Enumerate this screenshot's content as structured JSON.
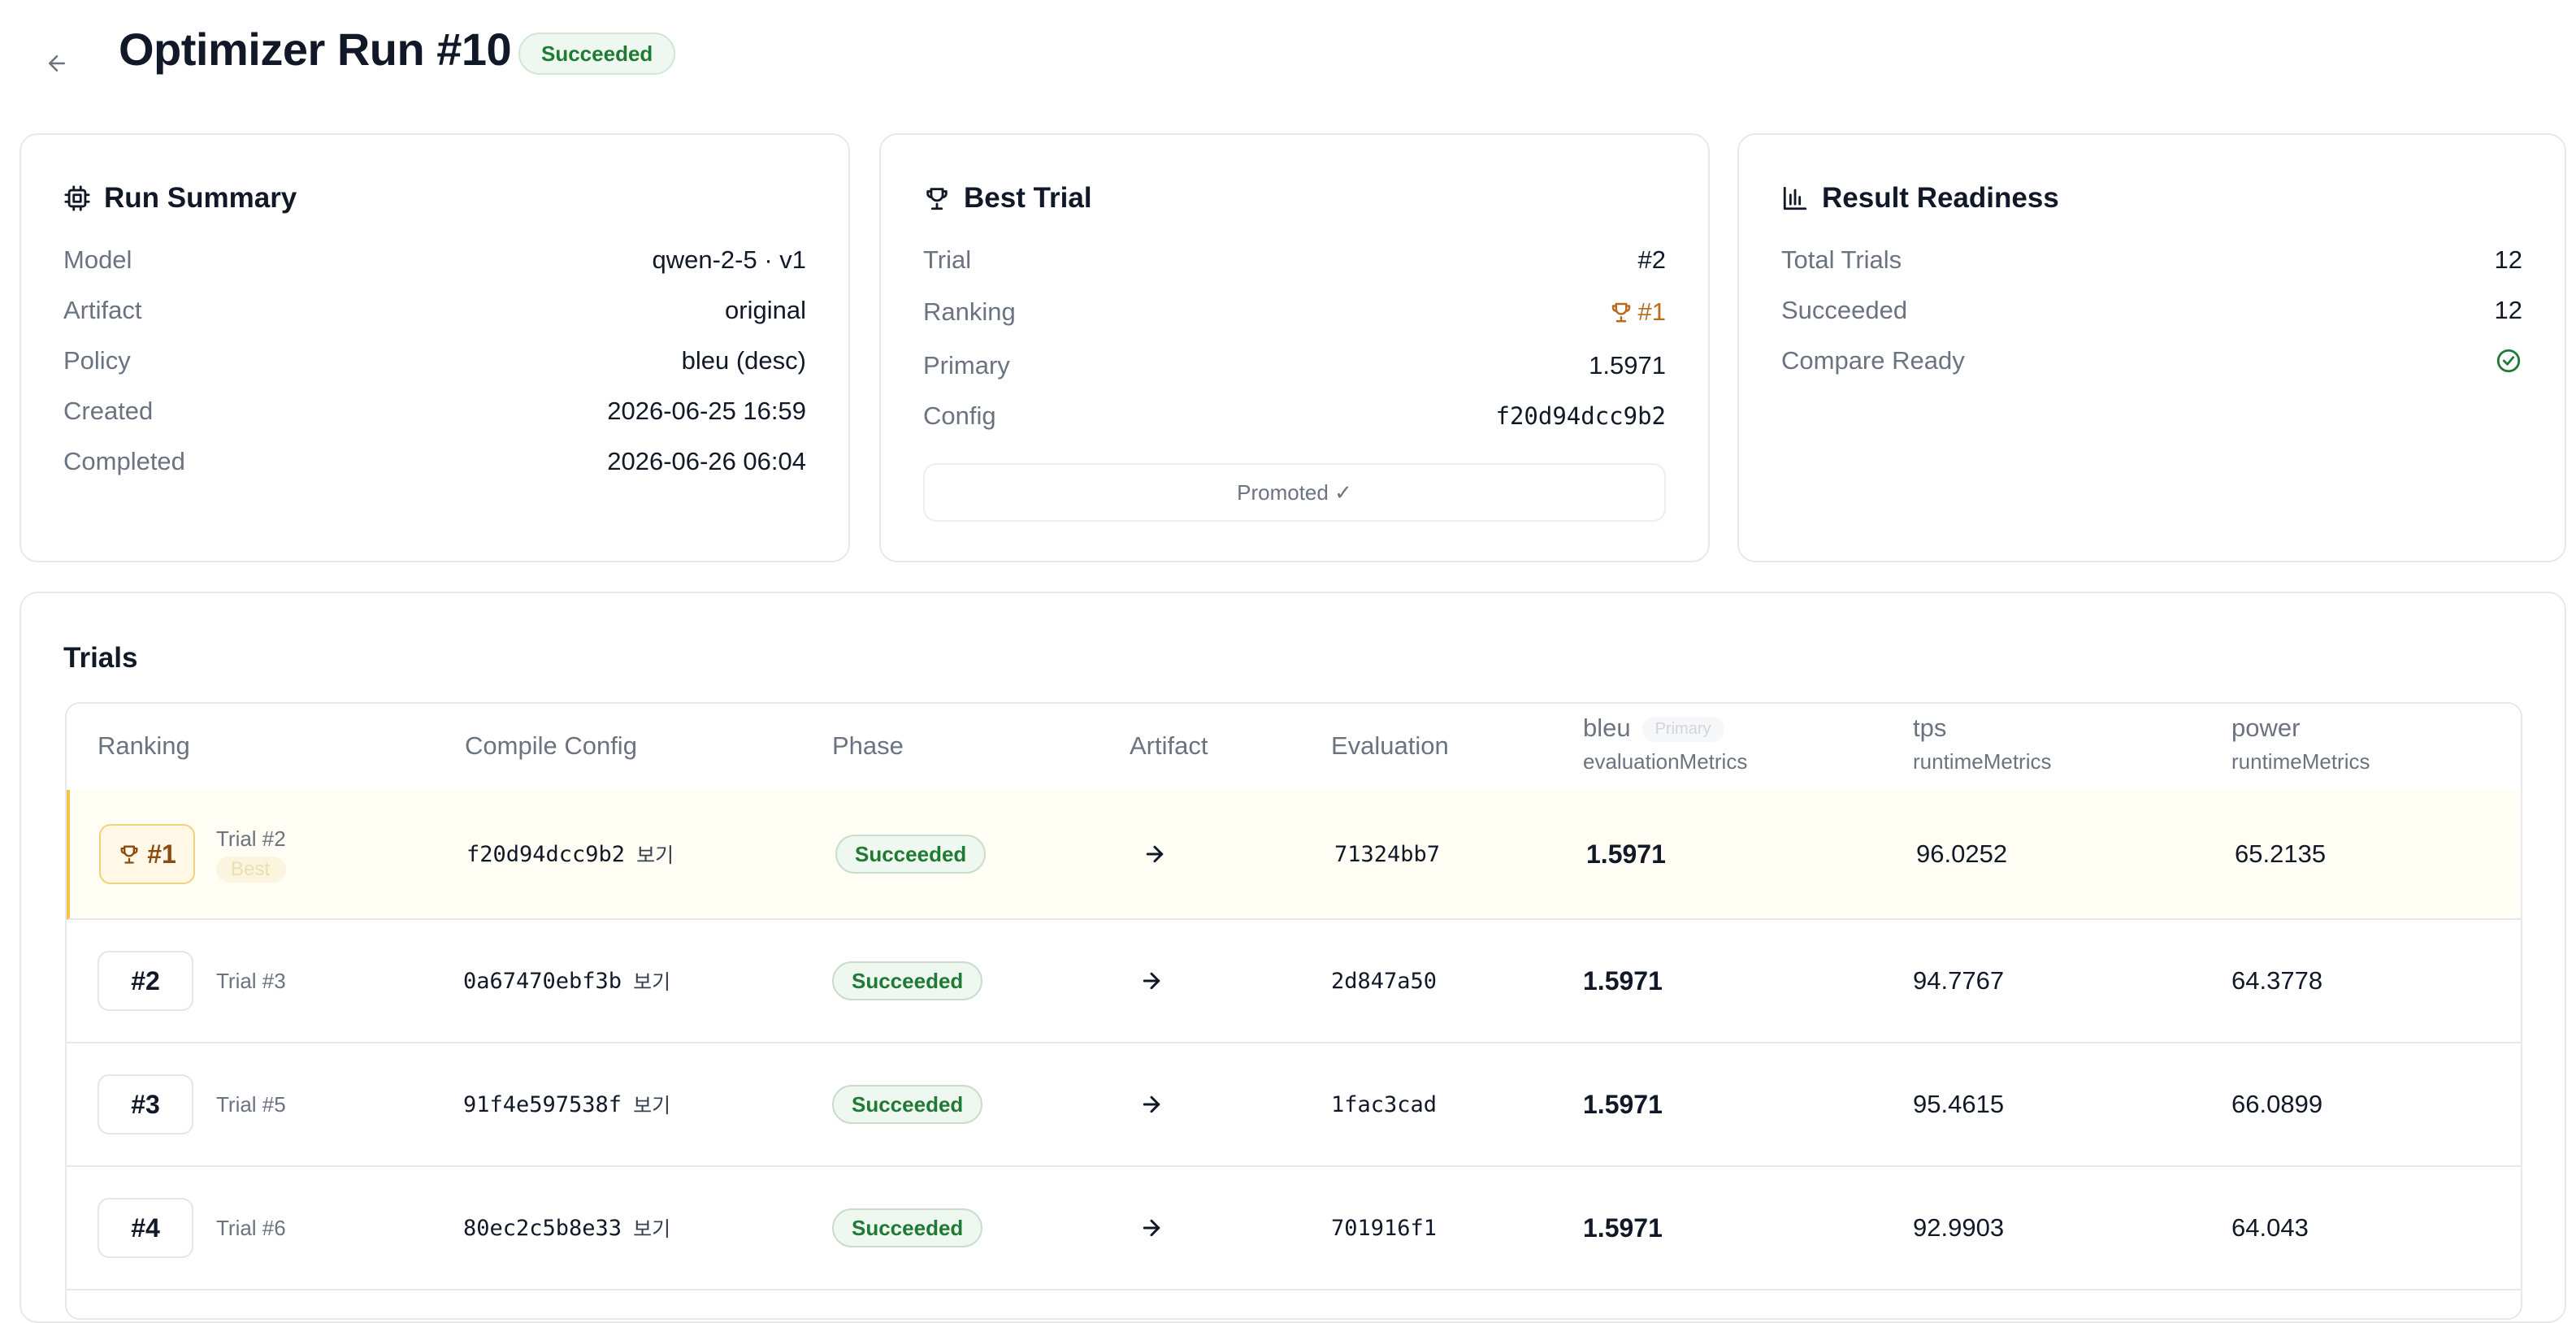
{
  "header": {
    "title": "Optimizer Run #10",
    "status": "Succeeded"
  },
  "run_summary": {
    "title": "Run Summary",
    "rows": [
      {
        "key": "Model",
        "value": "qwen-2-5 · v1"
      },
      {
        "key": "Artifact",
        "value": "original"
      },
      {
        "key": "Policy",
        "value": "bleu (desc)"
      },
      {
        "key": "Created",
        "value": "2026-06-25 16:59"
      },
      {
        "key": "Completed",
        "value": "2026-06-26 06:04"
      }
    ]
  },
  "best_trial": {
    "title": "Best Trial",
    "trial_label": "Trial",
    "trial_value": "#2",
    "ranking_label": "Ranking",
    "ranking_value": "#1",
    "primary_label": "Primary",
    "primary_value": "1.5971",
    "config_label": "Config",
    "config_value": "f20d94dcc9b2",
    "promoted": "Promoted ✓"
  },
  "readiness": {
    "title": "Result Readiness",
    "total_label": "Total Trials",
    "total_value": "12",
    "succeeded_label": "Succeeded",
    "succeeded_value": "12",
    "compare_label": "Compare Ready"
  },
  "trials": {
    "title": "Trials",
    "columns": {
      "ranking": "Ranking",
      "config": "Compile Config",
      "phase": "Phase",
      "artifact": "Artifact",
      "evaluation": "Evaluation",
      "bleu": "bleu",
      "bleu_pill": "Primary",
      "bleu_sub": "evaluationMetrics",
      "tps": "tps",
      "tps_sub": "runtimeMetrics",
      "power": "power",
      "power_sub": "runtimeMetrics"
    },
    "best_tag": "Best",
    "view_label": "보기",
    "rows": [
      {
        "rank": "#1",
        "trial": "Trial #2",
        "config": "f20d94dcc9b2",
        "phase": "Succeeded",
        "evaluation": "71324bb7",
        "bleu": "1.5971",
        "tps": "96.0252",
        "power": "65.2135"
      },
      {
        "rank": "#2",
        "trial": "Trial #3",
        "config": "0a67470ebf3b",
        "phase": "Succeeded",
        "evaluation": "2d847a50",
        "bleu": "1.5971",
        "tps": "94.7767",
        "power": "64.3778"
      },
      {
        "rank": "#3",
        "trial": "Trial #5",
        "config": "91f4e597538f",
        "phase": "Succeeded",
        "evaluation": "1fac3cad",
        "bleu": "1.5971",
        "tps": "95.4615",
        "power": "66.0899"
      },
      {
        "rank": "#4",
        "trial": "Trial #6",
        "config": "80ec2c5b8e33",
        "phase": "Succeeded",
        "evaluation": "701916f1",
        "bleu": "1.5971",
        "tps": "92.9903",
        "power": "64.043"
      }
    ]
  },
  "colors": {
    "success": "#1f7a34",
    "ranking_accent": "#b86a1e",
    "best_row_bg": "#fffdf4",
    "best_row_border": "#f3c34a"
  }
}
